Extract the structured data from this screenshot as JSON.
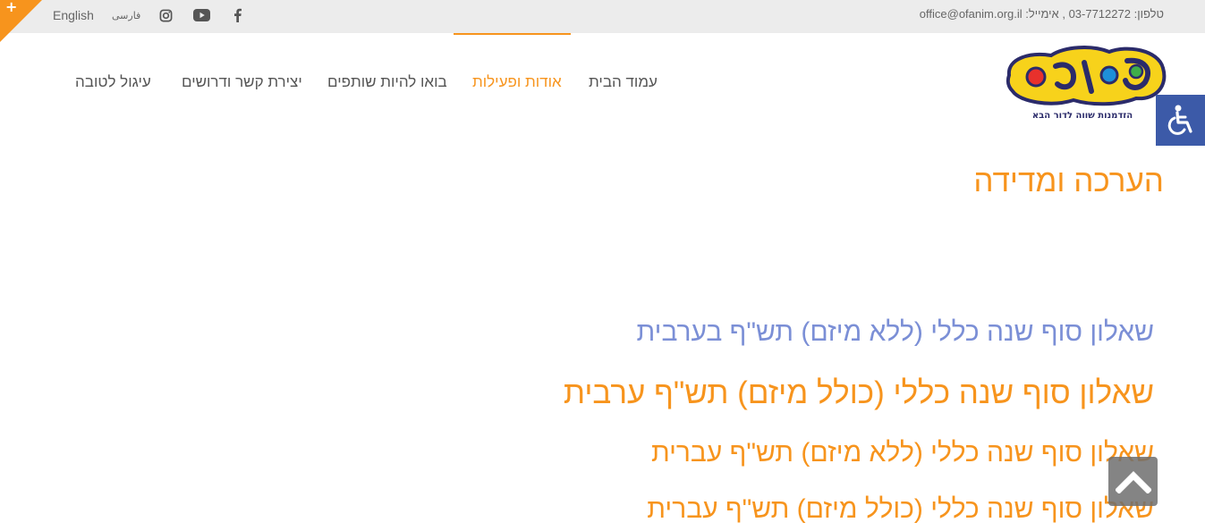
{
  "topbar": {
    "corner_symbol": "+",
    "languages": {
      "english": "English",
      "farsi": "فارسی"
    },
    "social": [
      {
        "name": "instagram-icon"
      },
      {
        "name": "youtube-icon"
      },
      {
        "name": "facebook-icon"
      }
    ],
    "contact": "טלפון: 03-7712272 , אימייל: office@ofanim.org.il"
  },
  "logo": {
    "title": "אופנים",
    "tagline": "הזדמנות שווה לדור הבא"
  },
  "nav": {
    "home": "עמוד הבית",
    "about": "אודות ופעילות",
    "partners": "בואו להיות שותפים",
    "contact": "יצירת קשר ודרושים",
    "anchor": "עיגול לטובה",
    "active": "about"
  },
  "page": {
    "title": "הערכה ומדידה"
  },
  "links": [
    "שאלון סוף שנה כללי (ללא מיזם) תש\"ף בערבית",
    "שאלון סוף שנה כללי (כולל מיזם) תש\"ף ערבית",
    "שאלון סוף שנה כללי (ללא מיזם) תש\"ף עברית",
    "שאלון סוף שנה כללי (כולל מיזם) תש\"ף עברית"
  ],
  "colors": {
    "accent": "#f7941d",
    "visited_link": "#7b8fd6",
    "accessibility": "#3c5aa8",
    "topbar": "#ececec"
  }
}
